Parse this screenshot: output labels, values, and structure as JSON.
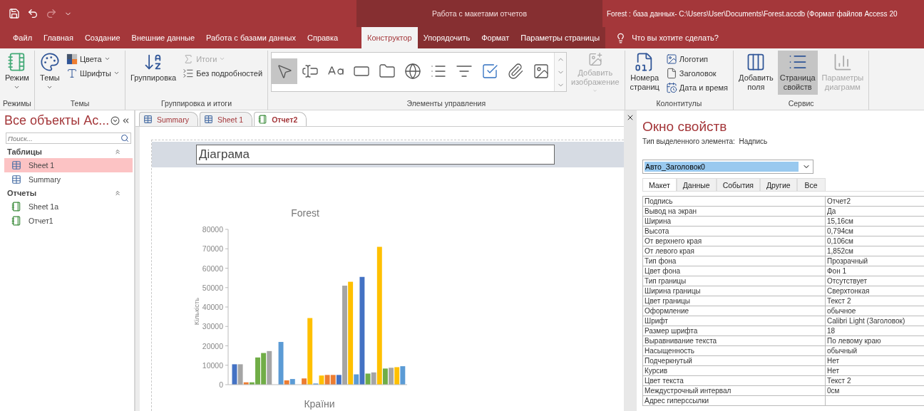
{
  "quick_access": [
    {
      "kind": "save",
      "disabled": false
    },
    {
      "kind": "undo",
      "disabled": false
    },
    {
      "kind": "redo",
      "disabled": true
    },
    {
      "kind": "customize",
      "disabled": false
    }
  ],
  "context_title": "Работа с макетами отчетов",
  "window_title": "Forest : база данных- C:\\Users\\User\\Documents\\Forest.accdb (Формат файлов Access 20",
  "menu_tabs": [
    {
      "label": "Файл",
      "selected": false,
      "context": false
    },
    {
      "label": "Главная",
      "selected": false,
      "context": false
    },
    {
      "label": "Создание",
      "selected": false,
      "context": false
    },
    {
      "label": "Внешние данные",
      "selected": false,
      "context": false
    },
    {
      "label": "Работа с базами данных",
      "selected": false,
      "context": false
    },
    {
      "label": "Справка",
      "selected": false,
      "context": false
    },
    {
      "label": "Конструктор",
      "selected": true,
      "context": true
    },
    {
      "label": "Упорядочить",
      "selected": false,
      "context": true
    },
    {
      "label": "Формат",
      "selected": false,
      "context": true
    },
    {
      "label": "Параметры страницы",
      "selected": false,
      "context": true
    }
  ],
  "tell_me": "Что вы хотите сделать?",
  "ribbon_groups": [
    {
      "label": "Режимы",
      "controls": [
        {
          "kind": "large",
          "label": "Режим",
          "dropdown": true,
          "disabled": false,
          "selected": false
        }
      ]
    },
    {
      "label": "Темы",
      "controls": [
        {
          "kind": "large",
          "label": "Темы",
          "dropdown": true,
          "disabled": false,
          "selected": false
        },
        {
          "kind": "small",
          "label": "Цвета",
          "dropdown": true,
          "disabled": false,
          "selected": false
        },
        {
          "kind": "small",
          "label": "Шрифты",
          "dropdown": true,
          "disabled": false,
          "selected": false
        }
      ]
    },
    {
      "label": "Группировка и итоги",
      "controls": [
        {
          "kind": "large",
          "label": "Группировка",
          "dropdown": false,
          "disabled": false,
          "selected": false
        },
        {
          "kind": "small",
          "label": "Итоги",
          "dropdown": true,
          "disabled": true,
          "selected": false
        },
        {
          "kind": "small",
          "label": "Без подробностей",
          "dropdown": false,
          "disabled": false,
          "selected": false
        }
      ]
    },
    {
      "label": "Элементы управления",
      "controls": [
        {
          "kind": "gallery",
          "items": [
            {
              "selected": true
            },
            {
              "selected": false
            },
            {
              "selected": false
            },
            {
              "selected": false
            },
            {
              "selected": false
            },
            {
              "selected": false
            },
            {
              "selected": false
            },
            {
              "selected": false
            },
            {
              "selected": false
            },
            {
              "selected": false
            },
            {
              "selected": false
            }
          ]
        },
        {
          "kind": "large",
          "label": "Добавить изображение",
          "dropdown": true,
          "disabled": true,
          "selected": false
        }
      ]
    },
    {
      "label": "Колонтитулы",
      "controls": [
        {
          "kind": "large",
          "label": "Номера страниц",
          "dropdown": false,
          "disabled": false,
          "selected": false
        },
        {
          "kind": "small",
          "label": "Логотип",
          "dropdown": false,
          "disabled": false,
          "selected": false
        },
        {
          "kind": "small",
          "label": "Заголовок",
          "dropdown": false,
          "disabled": false,
          "selected": false
        },
        {
          "kind": "small",
          "label": "Дата и время",
          "dropdown": false,
          "disabled": false,
          "selected": false
        }
      ]
    },
    {
      "label": "Сервис",
      "controls": [
        {
          "kind": "large",
          "label": "Добавить поля",
          "dropdown": false,
          "disabled": false,
          "selected": false
        },
        {
          "kind": "large",
          "label": "Страница свойств",
          "dropdown": false,
          "disabled": false,
          "selected": true
        },
        {
          "kind": "large",
          "label": "Параметры диаграмм",
          "dropdown": false,
          "disabled": true,
          "selected": false
        }
      ]
    }
  ],
  "nav": {
    "title": "Все объекты Ac...",
    "search_placeholder": "Поиск...",
    "groups": [
      {
        "label": "Таблицы",
        "expanded": true,
        "items": [
          {
            "label": "Sheet 1",
            "kind": "table",
            "selected": true
          },
          {
            "label": "Summary",
            "kind": "table",
            "selected": false
          }
        ]
      },
      {
        "label": "Отчеты",
        "expanded": true,
        "items": [
          {
            "label": "Sheet 1a",
            "kind": "report",
            "selected": false
          },
          {
            "label": "Отчет1",
            "kind": "report",
            "selected": false
          }
        ]
      }
    ]
  },
  "doc_tabs": [
    {
      "label": "Summary",
      "kind": "table",
      "selected": false
    },
    {
      "label": "Sheet 1",
      "kind": "table",
      "selected": false
    },
    {
      "label": "Отчет2",
      "kind": "report",
      "selected": true
    }
  ],
  "report": {
    "header_label": "Діаграма",
    "chart_data": {
      "type": "bar",
      "title": "Forest",
      "xlabel": "Країни",
      "ylabel": "Кількість",
      "ylim": [
        0,
        80000
      ],
      "yticks": [
        0,
        10000,
        20000,
        30000,
        40000,
        50000,
        60000,
        70000,
        80000
      ],
      "series": [
        {
          "color": "#4472c4",
          "values": [
            10500,
            null,
            null,
            null,
            null,
            null,
            null,
            null,
            null,
            null,
            null,
            null,
            null,
            null,
            null,
            null,
            null,
            null,
            5000,
            null,
            null,
            null,
            55500,
            null,
            null,
            null,
            null,
            null,
            null,
            null
          ]
        },
        {
          "color": "#a5a5a5",
          "values": [
            null,
            10500,
            null,
            null,
            null,
            null,
            17300,
            null,
            null,
            null,
            null,
            null,
            null,
            null,
            null,
            null,
            null,
            null,
            null,
            51000,
            null,
            null,
            null,
            null,
            6300,
            null,
            null,
            8700,
            null,
            null
          ]
        },
        {
          "color": "#ed7d31",
          "values": [
            null,
            null,
            1200,
            null,
            null,
            null,
            null,
            null,
            null,
            2200,
            null,
            null,
            3200,
            null,
            null,
            null,
            5000,
            5000,
            null,
            null,
            null,
            null,
            null,
            null,
            null,
            null,
            null,
            null,
            null,
            null
          ]
        },
        {
          "color": "#70ad47",
          "values": [
            null,
            null,
            null,
            1200,
            14000,
            16300,
            null,
            null,
            null,
            null,
            null,
            null,
            null,
            null,
            null,
            null,
            null,
            null,
            null,
            null,
            null,
            null,
            null,
            5700,
            null,
            null,
            8300,
            null,
            null,
            null
          ]
        },
        {
          "color": "#5b9bd5",
          "values": [
            null,
            null,
            null,
            null,
            null,
            null,
            null,
            null,
            22000,
            null,
            2900,
            null,
            null,
            null,
            600,
            null,
            null,
            null,
            null,
            null,
            null,
            5300,
            null,
            null,
            null,
            null,
            null,
            null,
            null,
            9500
          ]
        },
        {
          "color": "#ffc000",
          "values": [
            null,
            null,
            null,
            null,
            null,
            null,
            null,
            null,
            null,
            null,
            null,
            null,
            null,
            34300,
            null,
            4700,
            null,
            null,
            null,
            null,
            53000,
            null,
            null,
            null,
            null,
            71000,
            null,
            null,
            9000,
            null
          ]
        }
      ]
    }
  },
  "property_sheet": {
    "title": "Окно свойств",
    "selection_type_label": "Тип выделенного элемента:",
    "selection_type": "Надпись",
    "object": "Авто_Заголовок0",
    "tabs": [
      {
        "label": "Макет",
        "selected": true
      },
      {
        "label": "Данные",
        "selected": false
      },
      {
        "label": "События",
        "selected": false
      },
      {
        "label": "Другие",
        "selected": false
      },
      {
        "label": "Все",
        "selected": false
      }
    ],
    "rows": [
      {
        "name": "Подпись",
        "value": "Отчет2"
      },
      {
        "name": "Вывод на экран",
        "value": "Да"
      },
      {
        "name": "Ширина",
        "value": "15,16см"
      },
      {
        "name": "Высота",
        "value": "0,794см"
      },
      {
        "name": "От верхнего края",
        "value": "0,106см"
      },
      {
        "name": "От левого края",
        "value": "1,852см"
      },
      {
        "name": "Тип фона",
        "value": "Прозрачный"
      },
      {
        "name": "Цвет фона",
        "value": "Фон 1"
      },
      {
        "name": "Тип границы",
        "value": "Отсутствует"
      },
      {
        "name": "Ширина границы",
        "value": "Сверхтонкая"
      },
      {
        "name": "Цвет границы",
        "value": "Текст 2"
      },
      {
        "name": "Оформление",
        "value": "обычное"
      },
      {
        "name": "Шрифт",
        "value": "Calibri Light (Заголовок)"
      },
      {
        "name": "Размер шрифта",
        "value": "18"
      },
      {
        "name": "Выравнивание текста",
        "value": "По левому краю"
      },
      {
        "name": "Насыщенность",
        "value": "обычный"
      },
      {
        "name": "Подчеркнутый",
        "value": "Нет"
      },
      {
        "name": "Курсив",
        "value": "Нет"
      },
      {
        "name": "Цвет текста",
        "value": "Текст 2"
      },
      {
        "name": "Междустрочный интервал",
        "value": "0см"
      },
      {
        "name": "Адрес гиперссылки"
      }
    ]
  }
}
